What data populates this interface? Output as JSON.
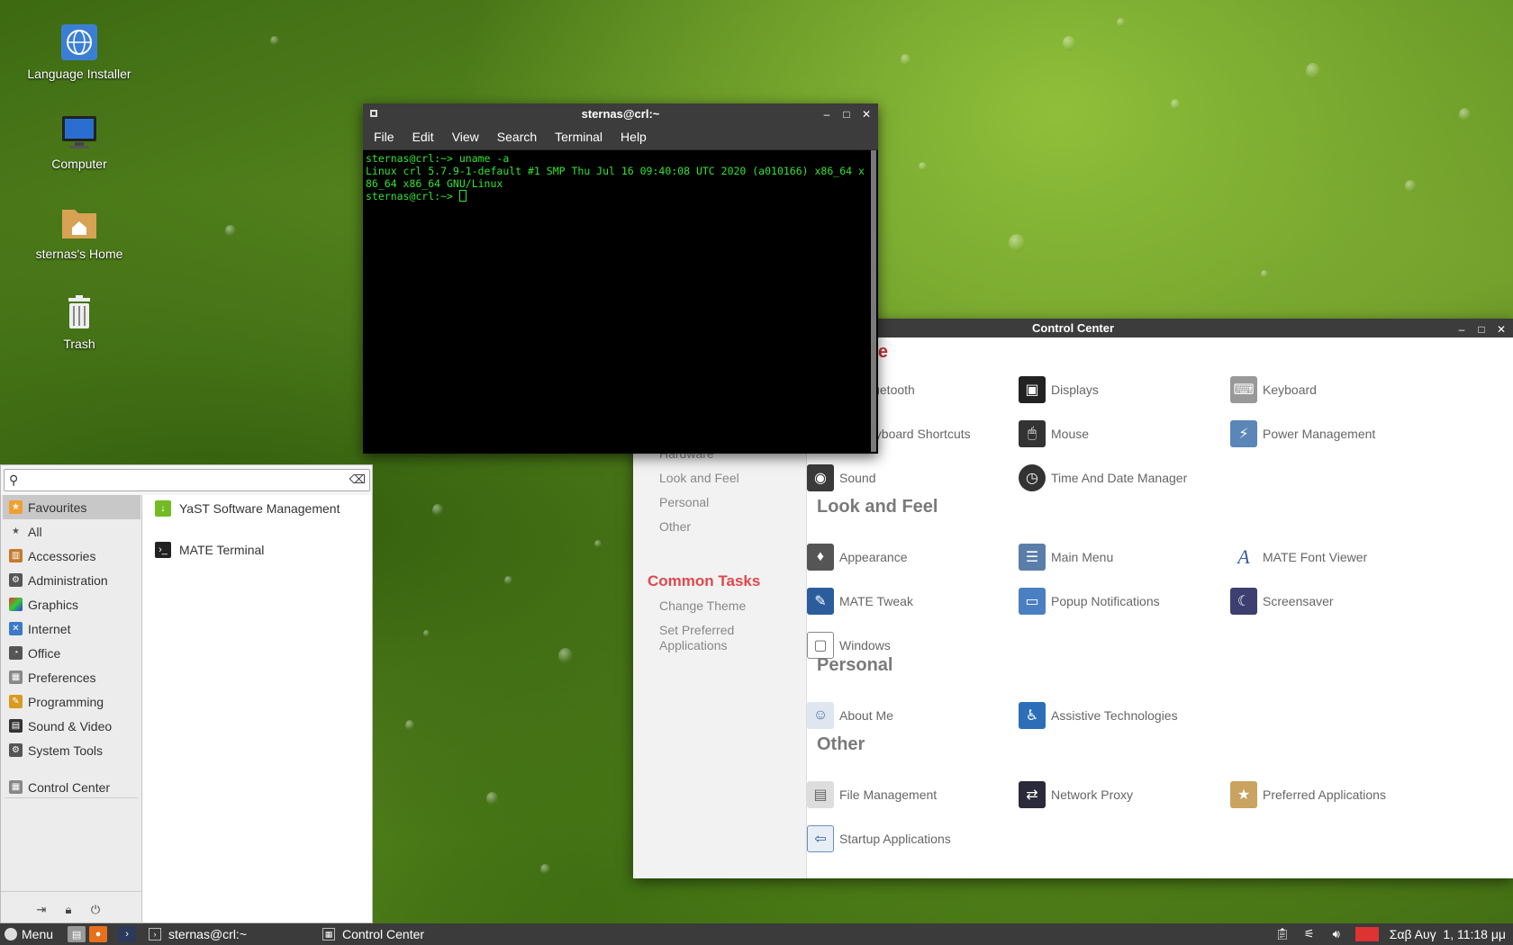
{
  "desktop": {
    "icons": [
      {
        "label": "Language Installer",
        "icon": "globe-icon"
      },
      {
        "label": "Computer",
        "icon": "monitor-icon"
      },
      {
        "label": "sternas's Home",
        "icon": "home-folder-icon"
      },
      {
        "label": "Trash",
        "icon": "trash-icon"
      }
    ]
  },
  "terminal": {
    "title": "sternas@crl:~",
    "menu": [
      "File",
      "Edit",
      "View",
      "Search",
      "Terminal",
      "Help"
    ],
    "lines": [
      "sternas@crl:~> uname -a",
      "Linux crl 5.7.9-1-default #1 SMP Thu Jul 16 09:40:08 UTC 2020 (a010166) x86_64 x",
      "86_64 x86_64 GNU/Linux",
      "sternas@crl:~> "
    ]
  },
  "control_center": {
    "title": "Control Center",
    "nav": [
      "Hardware",
      "Look and Feel",
      "Personal",
      "Other"
    ],
    "common_tasks": {
      "heading": "Common Tasks",
      "items": [
        "Change Theme",
        "Set Preferred Applications"
      ]
    },
    "sections": [
      {
        "title": "Hardware",
        "visible_title": "are",
        "items": [
          "Bluetooth",
          "Displays",
          "Keyboard",
          "Keyboard Shortcuts",
          "Mouse",
          "Power Management",
          "Sound",
          "Time And Date Manager"
        ]
      },
      {
        "title": "Look and Feel",
        "items": [
          "Appearance",
          "Main Menu",
          "MATE Font Viewer",
          "MATE Tweak",
          "Popup Notifications",
          "Screensaver",
          "Windows"
        ]
      },
      {
        "title": "Personal",
        "items": [
          "About Me",
          "Assistive Technologies"
        ]
      },
      {
        "title": "Other",
        "items": [
          "File Management",
          "Network Proxy",
          "Preferred Applications",
          "Startup Applications"
        ]
      }
    ],
    "partial_labels": {
      "bluetooth": "luetooth",
      "keyboard_shortcuts": "eyboard Shortcuts"
    }
  },
  "app_menu": {
    "search": {
      "value": "",
      "placeholder": ""
    },
    "categories": [
      "Favourites",
      "All",
      "Accessories",
      "Administration",
      "Graphics",
      "Internet",
      "Office",
      "Preferences",
      "Programming",
      "Sound & Video",
      "System Tools",
      "Control Center"
    ],
    "active_category": "Favourites",
    "apps": [
      "YaST Software Management",
      "MATE Terminal"
    ]
  },
  "taskbar": {
    "menu_label": "Menu",
    "tasks": [
      {
        "label": "sternas@crl:~",
        "icon": "terminal-icon"
      },
      {
        "label": "Control Center",
        "icon": "control-center-icon"
      }
    ],
    "clock": "Σαβ Αυγ  1, 11:18 μμ"
  },
  "colors": {
    "accent_red": "#c13237",
    "terminal_green": "#33e333",
    "panel": "#3b3b3b"
  }
}
